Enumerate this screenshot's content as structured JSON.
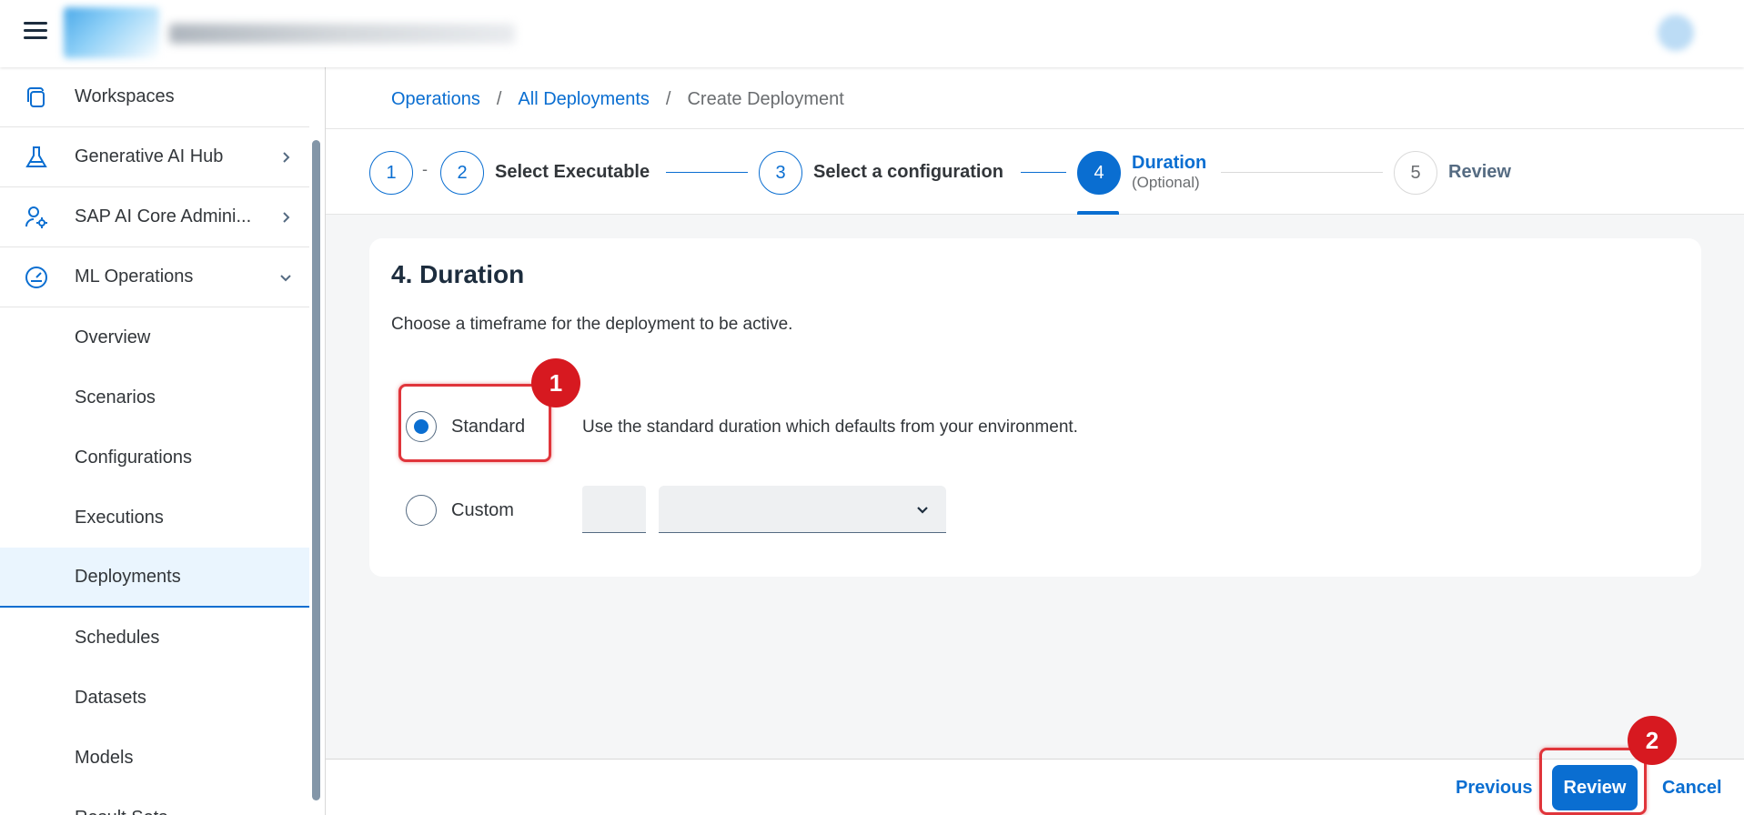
{
  "shell": {
    "menu_icon": "hamburger-icon",
    "logo_icon": "company-logo-blurred",
    "title_icon": "app-title-blurred",
    "avatar_icon": "user-avatar-blurred"
  },
  "sidebar": {
    "items": [
      {
        "label": "Workspaces",
        "icon": "workspaces-icon"
      },
      {
        "label": "Generative AI Hub",
        "icon": "flask-icon",
        "chevron": "chevron-right"
      },
      {
        "label": "SAP AI Core Admini...",
        "icon": "user-settings-icon",
        "chevron": "chevron-right"
      },
      {
        "label": "ML Operations",
        "icon": "dashboard-gauge-icon",
        "chevron": "chevron-down"
      }
    ],
    "sub_items": [
      {
        "label": "Overview"
      },
      {
        "label": "Scenarios"
      },
      {
        "label": "Configurations"
      },
      {
        "label": "Executions"
      },
      {
        "label": "Deployments",
        "selected": true
      },
      {
        "label": "Schedules"
      },
      {
        "label": "Datasets"
      },
      {
        "label": "Models"
      },
      {
        "label": "Result Sets"
      }
    ]
  },
  "breadcrumb": {
    "items": [
      "Operations",
      "All Deployments"
    ],
    "separator": "/",
    "current": "Create Deployment"
  },
  "wizard": {
    "steps": [
      {
        "number": "1",
        "title": ""
      },
      {
        "number": "2",
        "title": "Select Executable"
      },
      {
        "number": "3",
        "title": "Select a configuration"
      },
      {
        "number": "4",
        "title": "Duration",
        "subtitle": "(Optional)",
        "active": true
      },
      {
        "number": "5",
        "title": "Review"
      }
    ],
    "dash": "-"
  },
  "duration": {
    "title": "4. Duration",
    "description": "Choose a timeframe for the deployment to be active.",
    "options": [
      {
        "label": "Standard",
        "checked": true,
        "description": "Use the standard duration which defaults from your environment."
      },
      {
        "label": "Custom",
        "checked": false
      }
    ],
    "custom_value": "",
    "custom_unit": ""
  },
  "annotations": {
    "badge1": "1",
    "badge2": "2",
    "color": "#d71920"
  },
  "footer": {
    "previous": "Previous",
    "review": "Review",
    "cancel": "Cancel"
  },
  "colors": {
    "accent": "#0a6ed1",
    "selected_bg": "#eaf5fe",
    "page_bg": "#f5f6f7"
  }
}
